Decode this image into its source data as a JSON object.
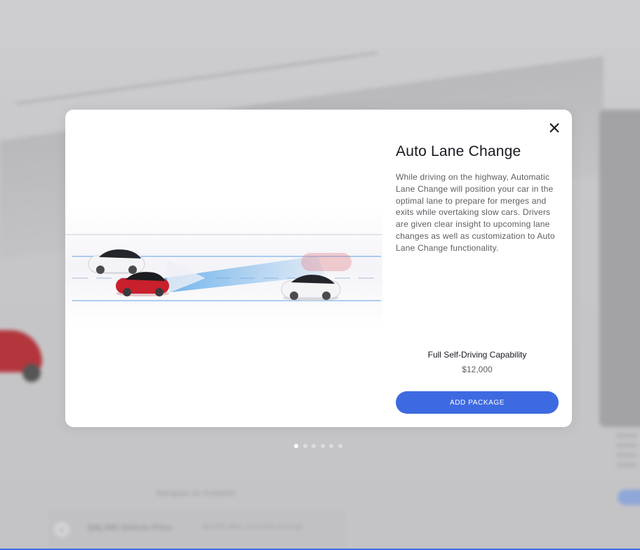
{
  "modal": {
    "title": "Auto Lane Change",
    "description": "While driving on the highway, Automatic Lane Change will position your car in the optimal lane to prepare for merges and exits while overtaking slow cars. Drivers are given clear insight to upcoming lane changes as well as customization to Auto Lane Change functionality.",
    "close_icon": "close-icon",
    "package_name": "Full Self-Driving Capability",
    "package_price": "$12,000",
    "add_button_label": "ADD PACKAGE"
  },
  "pagination": {
    "total": 6,
    "active_index": 0
  },
  "background": {
    "section_title": "Navigate on Autopilot",
    "price_label": "$46,490 Vehicle Price",
    "savings_label": "$0,000 after potential savings"
  },
  "colors": {
    "accent": "#3e6ae1",
    "title_text": "#171a20",
    "body_text": "#5c5e62",
    "red_car": "#c8202c"
  }
}
